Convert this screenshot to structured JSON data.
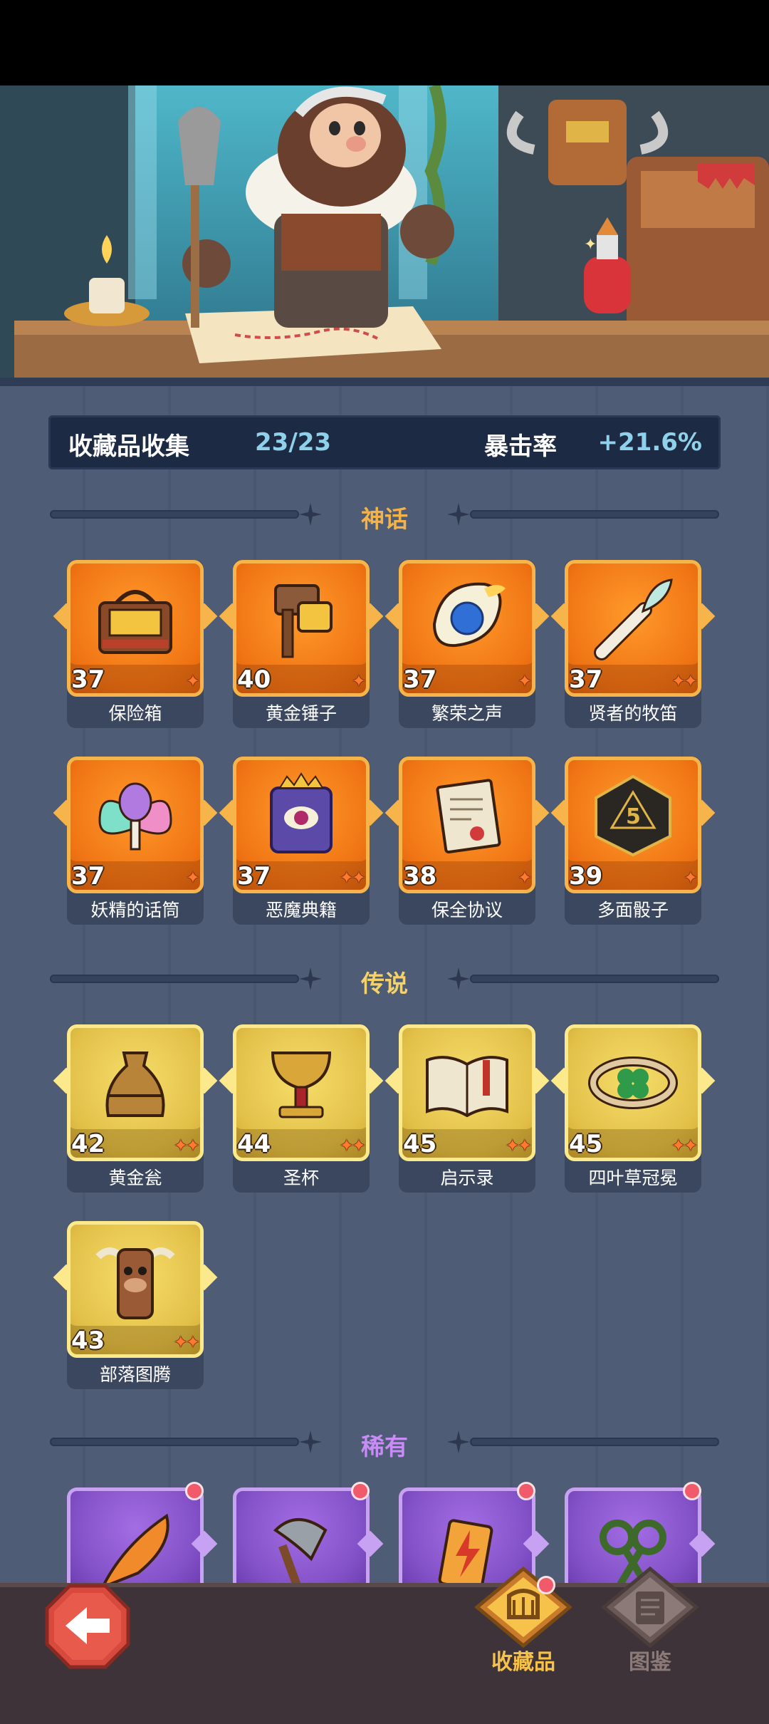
{
  "summary": {
    "title": "收藏品收集",
    "count": "23/23",
    "crit_label": "暴击率",
    "crit_value": "+21.6%"
  },
  "sections": {
    "myth": {
      "label": "神话",
      "color": "#f3b24a"
    },
    "legend": {
      "label": "传说",
      "color": "#f3d26e"
    },
    "rare": {
      "label": "稀有",
      "color": "#c78cf5"
    }
  },
  "myth_items": [
    {
      "name": "保险箱",
      "level": "37",
      "stars": 1,
      "icon": "treasure-chest-icon"
    },
    {
      "name": "黄金锤子",
      "level": "40",
      "stars": 1,
      "icon": "golden-hammer-icon"
    },
    {
      "name": "繁荣之声",
      "level": "37",
      "stars": 1,
      "icon": "conch-shell-icon"
    },
    {
      "name": "贤者的牧笛",
      "level": "37",
      "stars": 2,
      "icon": "flute-icon"
    },
    {
      "name": "妖精的话筒",
      "level": "37",
      "stars": 1,
      "icon": "fairy-microphone-icon"
    },
    {
      "name": "恶魔典籍",
      "level": "37",
      "stars": 2,
      "icon": "demon-book-icon"
    },
    {
      "name": "保全协议",
      "level": "38",
      "stars": 1,
      "icon": "scroll-contract-icon"
    },
    {
      "name": "多面骰子",
      "level": "39",
      "stars": 1,
      "icon": "d20-dice-icon"
    }
  ],
  "legend_items": [
    {
      "name": "黄金瓮",
      "level": "42",
      "stars": 2,
      "icon": "golden-urn-icon"
    },
    {
      "name": "圣杯",
      "level": "44",
      "stars": 2,
      "icon": "holy-grail-icon"
    },
    {
      "name": "启示录",
      "level": "45",
      "stars": 2,
      "icon": "open-book-icon"
    },
    {
      "name": "四叶草冠冕",
      "level": "45",
      "stars": 2,
      "icon": "clover-crown-icon"
    },
    {
      "name": "部落图腾",
      "level": "43",
      "stars": 2,
      "icon": "tribal-totem-icon"
    }
  ],
  "rare_items": [
    {
      "icon": "feather-icon"
    },
    {
      "icon": "axe-icon"
    },
    {
      "icon": "lightning-card-icon"
    },
    {
      "icon": "vine-scissors-icon"
    }
  ],
  "nav": {
    "collection_label": "收藏品",
    "codex_label": "图鉴",
    "active_color": "#f6c24a",
    "inactive_color": "#8b7a78"
  },
  "star_glyph": "✦"
}
